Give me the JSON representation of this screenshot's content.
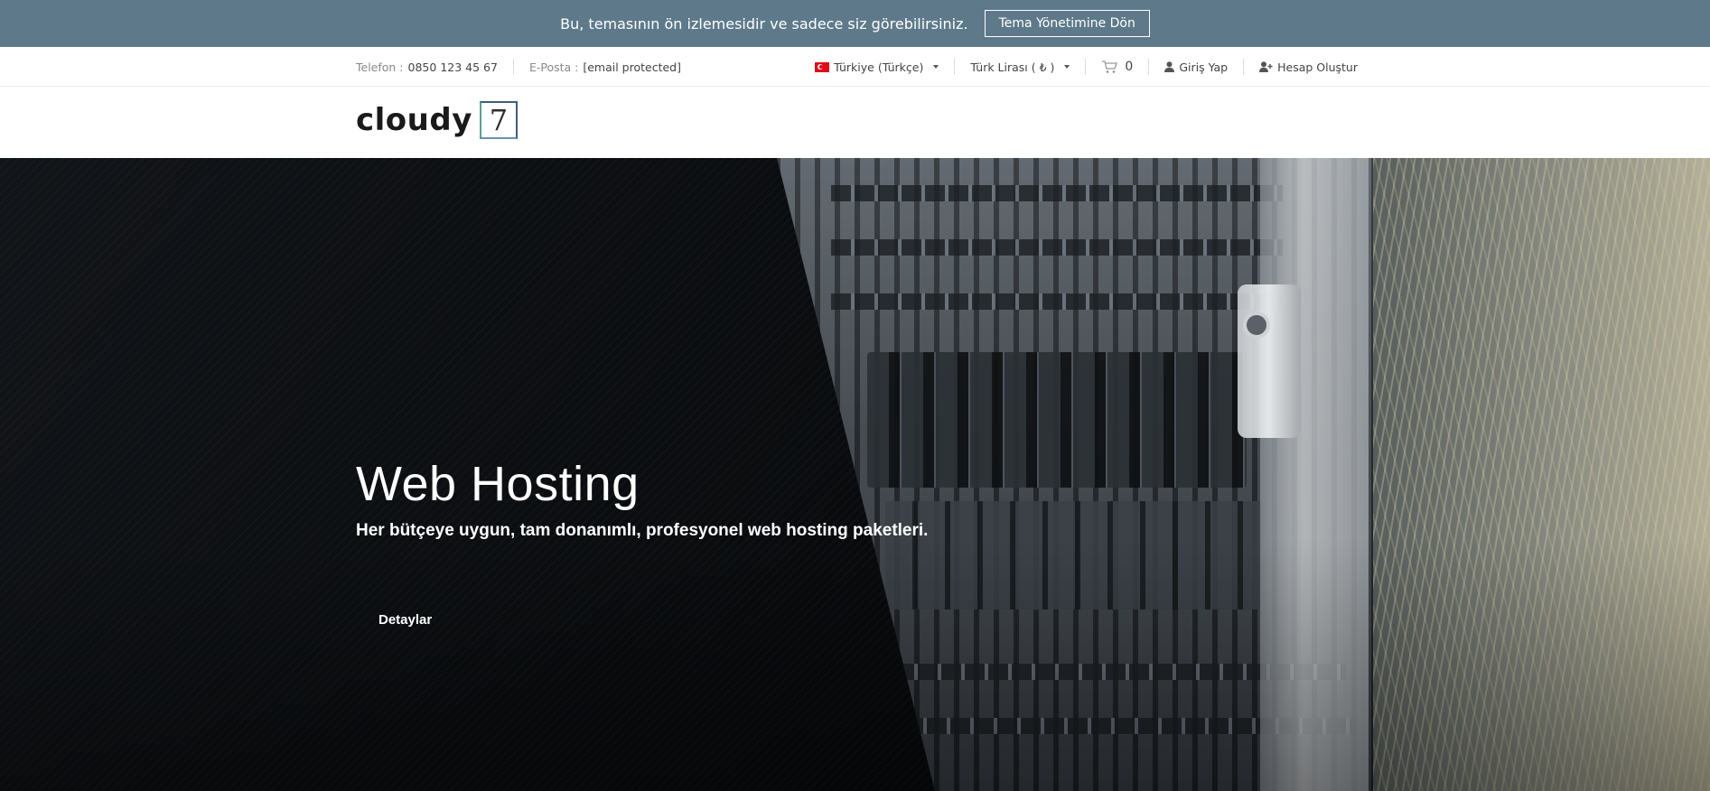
{
  "preview_bar": {
    "message": "Bu, temasının ön izlemesidir ve sadece siz görebilirsiniz.",
    "button_label": "Tema Yönetimine Dön"
  },
  "topbar": {
    "phone_label": "Telefon :",
    "phone_value": "0850 123 45 67",
    "email_label": "E-Posta :",
    "email_value": "[email protected]",
    "language": "Türkiye (Türkçe)",
    "currency": "Türk Lirası ( ₺ )",
    "cart_count": "0",
    "login": "Giriş Yap",
    "register": "Hesap Oluştur"
  },
  "header": {
    "logo_text": "cloudy",
    "logo_mark": "7"
  },
  "hero": {
    "title": "Web Hosting",
    "subtitle": "Her bütçeye uygun, tam donanımlı, profesyonel web hosting paketleri.",
    "button_label": "Detaylar"
  },
  "colors": {
    "preview_bar_bg": "#5e7a8a",
    "hero_bg": "#0a0c0f",
    "text_white": "#ffffff"
  },
  "icons": [
    "flag-tr-icon",
    "caret-down-icon",
    "cart-icon",
    "user-icon",
    "user-plus-icon"
  ]
}
